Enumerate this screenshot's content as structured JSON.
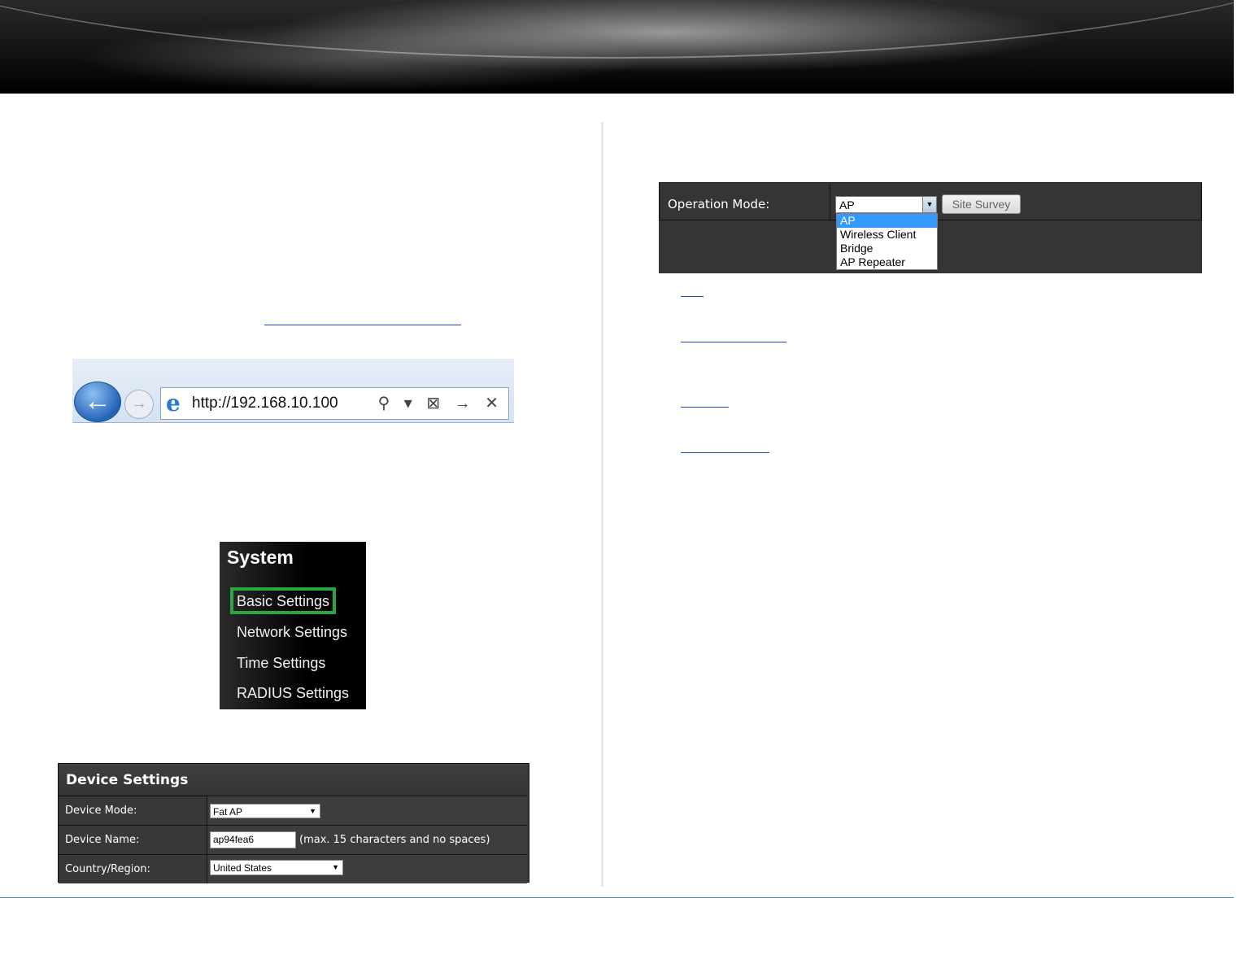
{
  "browser": {
    "url": "http://192.168.10.100",
    "tool_icons": "⚲ ▾ ⊠ → ✕"
  },
  "system_menu": {
    "title": "System",
    "items": [
      "Basic Settings",
      "Network Settings",
      "Time Settings",
      "RADIUS Settings"
    ],
    "highlighted": "Basic Settings"
  },
  "device_settings": {
    "title": "Device Settings",
    "rows": [
      {
        "label": "Device Mode:",
        "value": "Fat AP"
      },
      {
        "label": "Device Name:",
        "value": "ap94fea6",
        "hint": "(max. 15 characters and no spaces)"
      },
      {
        "label": "Country/Region:",
        "value": "United States"
      }
    ]
  },
  "operation_mode": {
    "label": "Operation Mode:",
    "selected": "AP",
    "site_survey_label": "Site Survey",
    "options": [
      "AP",
      "Wireless Client",
      "Bridge",
      "AP Repeater"
    ]
  },
  "colors": {
    "highlight_border": "#27a843",
    "selected_option": "#3399ff",
    "link": "#1f3fd0",
    "footer_rule": "#4f81a6"
  }
}
